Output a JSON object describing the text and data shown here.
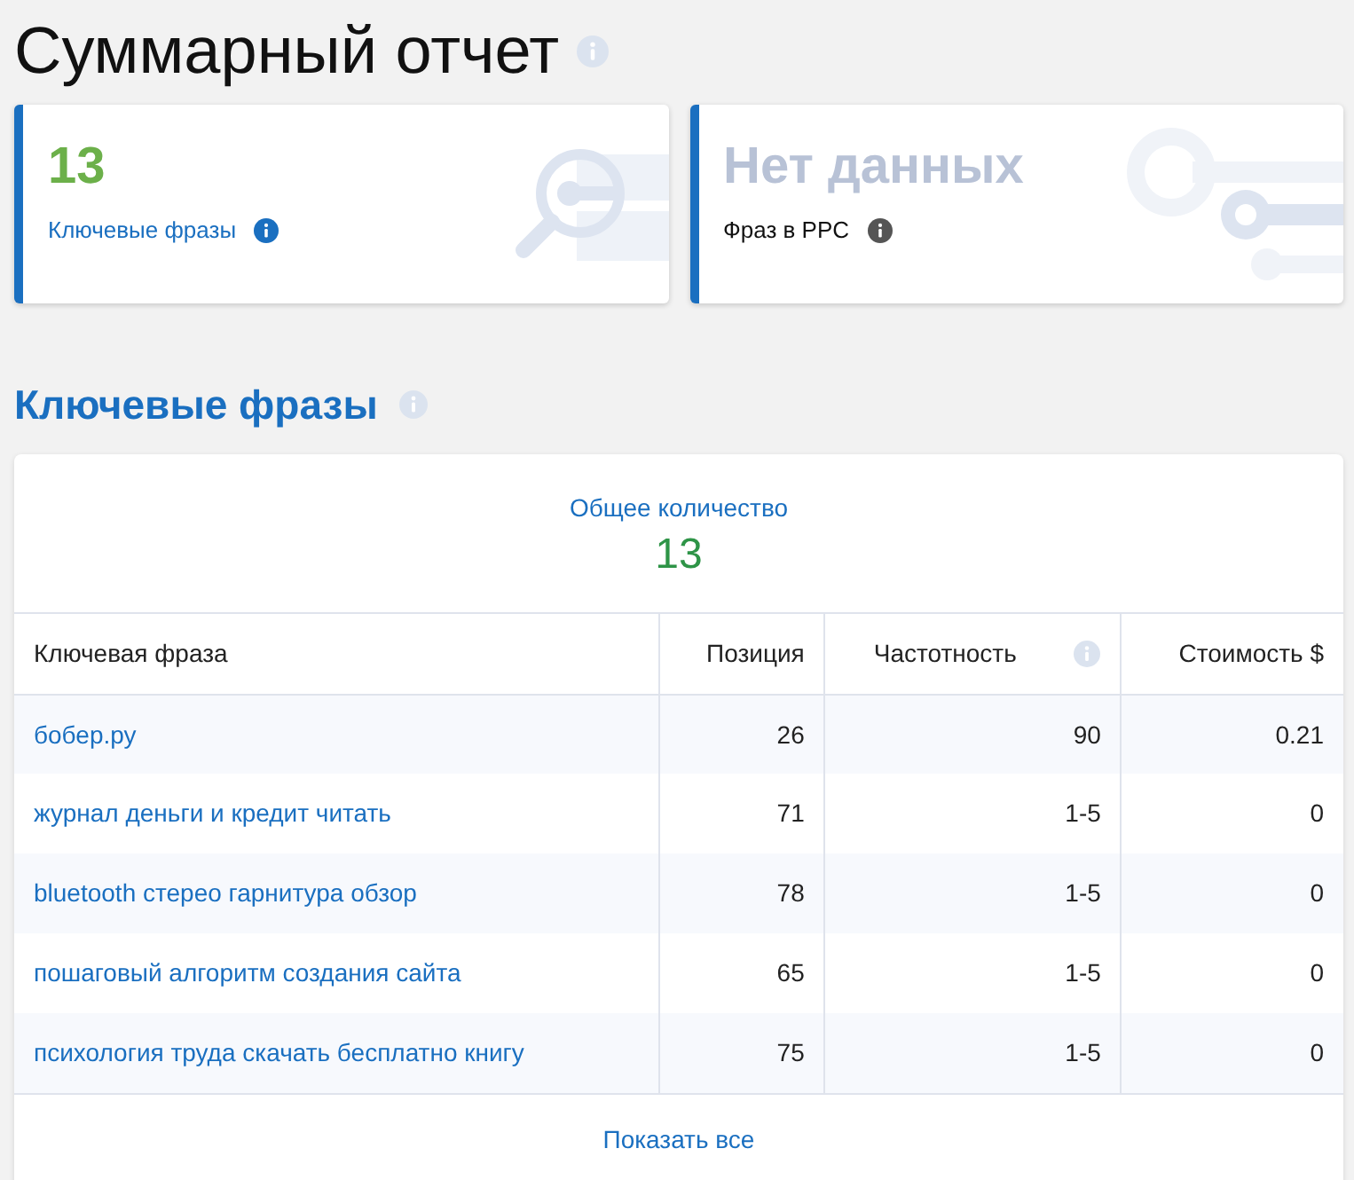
{
  "page": {
    "title": "Суммарный отчет"
  },
  "cards": [
    {
      "value": "13",
      "label": "Ключевые фразы",
      "has_data": true
    },
    {
      "value": "Нет данных",
      "label": "Фраз в PPC",
      "has_data": false
    }
  ],
  "section": {
    "title": "Ключевые фразы",
    "total_label": "Общее количество",
    "total_value": "13",
    "table": {
      "columns": [
        "Ключевая фраза",
        "Позиция",
        "Частотность",
        "Стоимость $"
      ],
      "rows": [
        [
          "бобер.ру",
          "26",
          "90",
          "0.21"
        ],
        [
          "журнал деньги и кредит читать",
          "71",
          "1-5",
          "0"
        ],
        [
          "bluetooth стерео гарнитура обзор",
          "78",
          "1-5",
          "0"
        ],
        [
          "пошаговый алгоритм создания сайта",
          "65",
          "1-5",
          "0"
        ],
        [
          "психология труда скачать бесплатно книгу",
          "75",
          "1-5",
          "0"
        ]
      ]
    },
    "show_all": "Показать все"
  }
}
